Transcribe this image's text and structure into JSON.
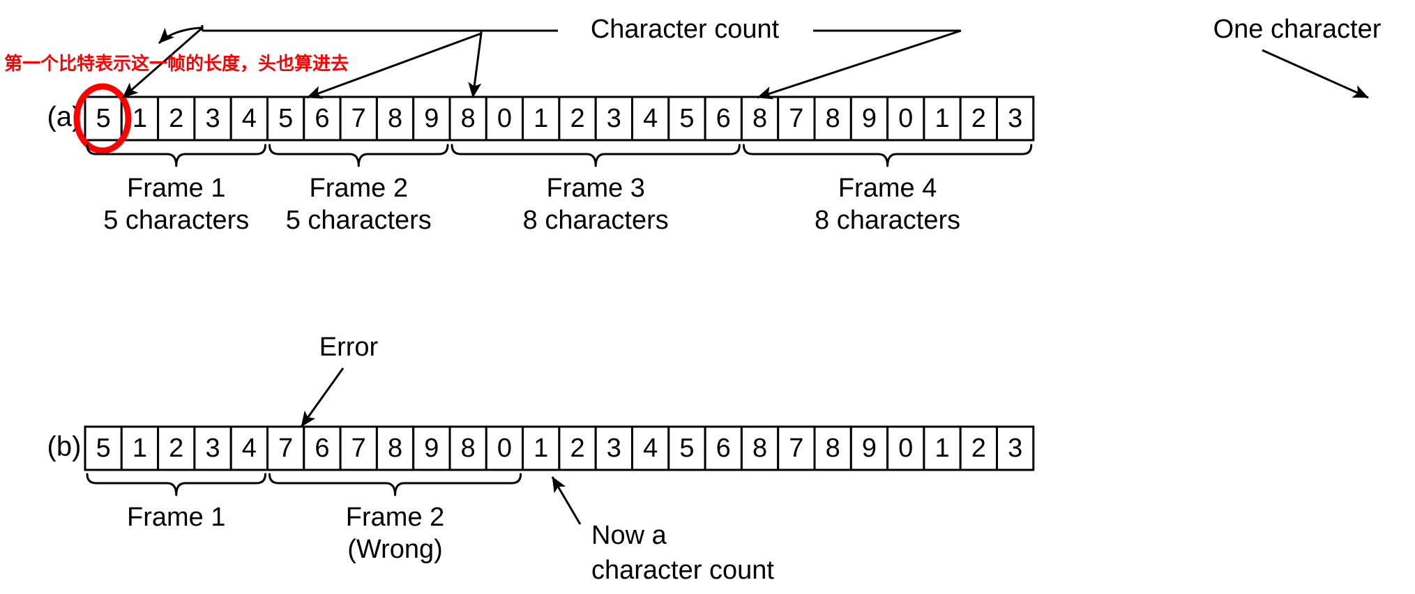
{
  "figure": {
    "title_annotations": {
      "character_count": "Character count",
      "one_character": "One character",
      "error": "Error",
      "now_a_character_count_line1": "Now a",
      "now_a_character_count_line2": "character count"
    },
    "chinese_note": "第一个比特表示这一帧的长度，头也算进去",
    "colors": {
      "highlight": "#ff0000",
      "note_text": "#ff0000",
      "line": "#000000",
      "cell_fill": "#ffffff"
    }
  },
  "rows": [
    {
      "label": "(a)",
      "cells": [
        "5",
        "1",
        "2",
        "3",
        "4",
        "5",
        "6",
        "7",
        "8",
        "9",
        "8",
        "0",
        "1",
        "2",
        "3",
        "4",
        "5",
        "6",
        "8",
        "7",
        "8",
        "9",
        "0",
        "1",
        "2",
        "3"
      ],
      "highlighted_cell_index": 0,
      "frames": [
        {
          "label_line1": "Frame 1",
          "label_line2": "5 characters",
          "start": 0,
          "count": 5
        },
        {
          "label_line1": "Frame 2",
          "label_line2": "5 characters",
          "start": 5,
          "count": 5
        },
        {
          "label_line1": "Frame 3",
          "label_line2": "8 characters",
          "start": 10,
          "count": 8
        },
        {
          "label_line1": "Frame 4",
          "label_line2": "8 characters",
          "start": 18,
          "count": 8
        }
      ],
      "character_count_cells": [
        0,
        5,
        10,
        18
      ],
      "one_character_cell": 25
    },
    {
      "label": "(b)",
      "cells": [
        "5",
        "1",
        "2",
        "3",
        "4",
        "7",
        "6",
        "7",
        "8",
        "9",
        "8",
        "0",
        "1",
        "2",
        "3",
        "4",
        "5",
        "6",
        "8",
        "7",
        "8",
        "9",
        "0",
        "1",
        "2",
        "3"
      ],
      "error_cell_index": 5,
      "now_a_character_count_cell_index": 12,
      "frames": [
        {
          "label_line1": "Frame 1",
          "label_line2": "",
          "start": 0,
          "count": 5
        },
        {
          "label_line1": "Frame 2",
          "label_line2": "(Wrong)",
          "start": 5,
          "count": 7
        }
      ]
    }
  ]
}
